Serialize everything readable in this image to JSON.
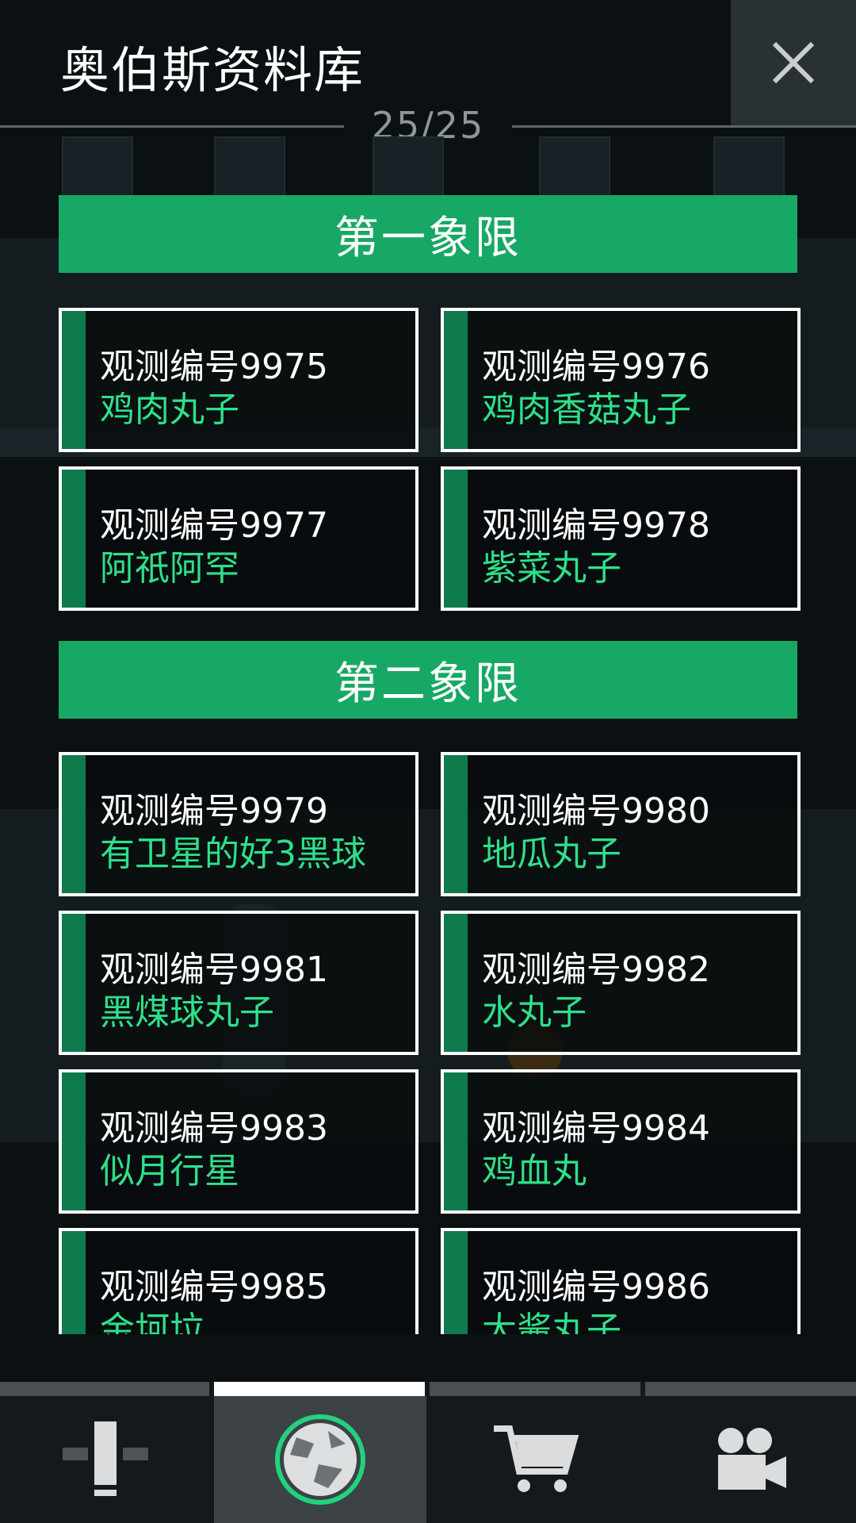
{
  "header": {
    "title": "奥伯斯资料库",
    "counter": "25/25"
  },
  "sections": [
    {
      "title": "第一象限",
      "items": [
        {
          "number": "观测编号9975",
          "name": "鸡肉丸子"
        },
        {
          "number": "观测编号9976",
          "name": "鸡肉香菇丸子"
        },
        {
          "number": "观测编号9977",
          "name": "阿祇阿罕"
        },
        {
          "number": "观测编号9978",
          "name": "紫菜丸子"
        }
      ]
    },
    {
      "title": "第二象限",
      "items": [
        {
          "number": "观测编号9979",
          "name": "有卫星的好3黑球"
        },
        {
          "number": "观测编号9980",
          "name": "地瓜丸子"
        },
        {
          "number": "观测编号9981",
          "name": "黑煤球丸子"
        },
        {
          "number": "观测编号9982",
          "name": "水丸子"
        },
        {
          "number": "观测编号9983",
          "name": "似月行星"
        },
        {
          "number": "观测编号9984",
          "name": "鸡血丸"
        },
        {
          "number": "观测编号9985",
          "name": "金坷垃"
        },
        {
          "number": "观测编号9986",
          "name": "大酱丸子"
        }
      ]
    }
  ],
  "tabs": [
    {
      "icon": "telescope-icon",
      "active": false
    },
    {
      "icon": "planet-icon",
      "active": true
    },
    {
      "icon": "cart-icon",
      "active": false
    },
    {
      "icon": "video-camera-icon",
      "active": false
    }
  ],
  "colors": {
    "accent": "#18a865",
    "accent_dark": "#0f7a4c",
    "name_text": "#2ee08a",
    "background": "#0b1013"
  }
}
